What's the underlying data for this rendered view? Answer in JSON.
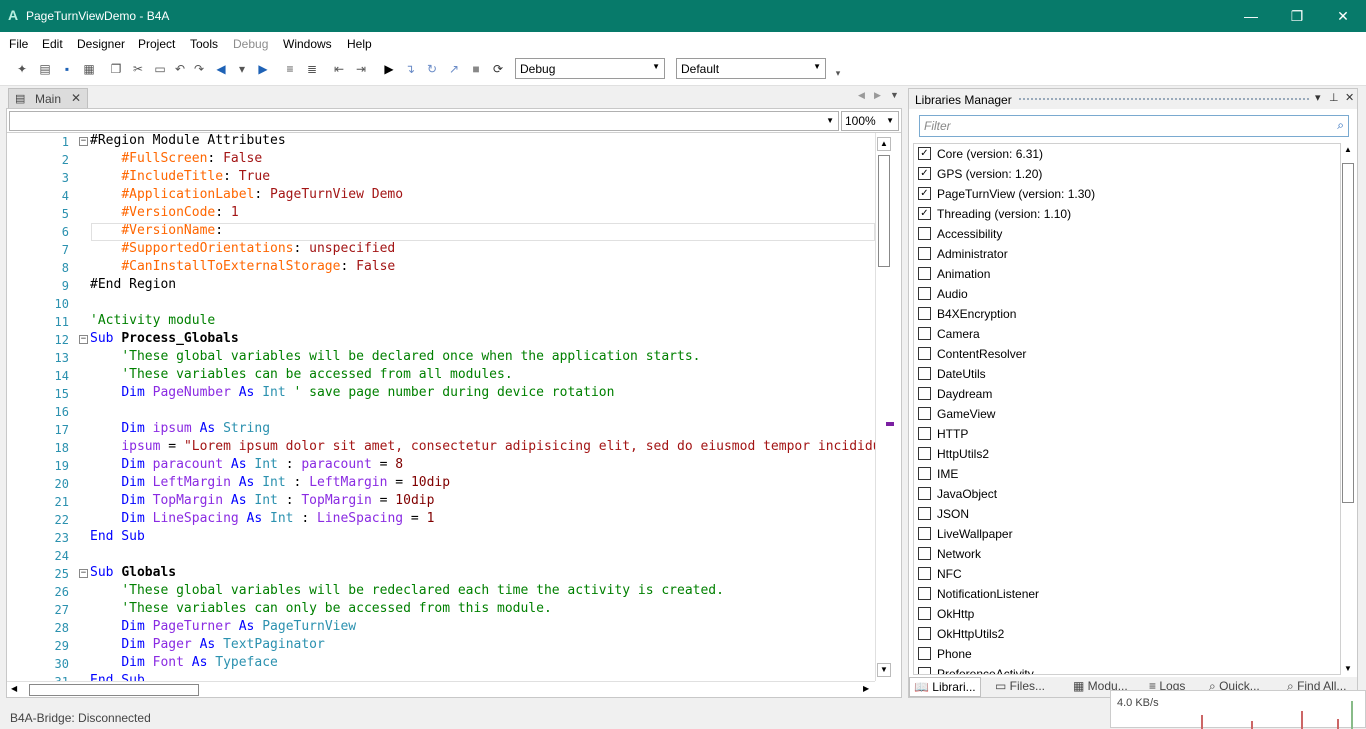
{
  "window": {
    "title": "PageTurnViewDemo - B4A",
    "logo": "A"
  },
  "menu": [
    "File",
    "Edit",
    "Designer",
    "Project",
    "Tools",
    "Debug",
    "Windows",
    "Help"
  ],
  "toolbar": {
    "build_mode": "Debug",
    "build_config": "Default"
  },
  "doc_tab": {
    "label": "Main"
  },
  "editor": {
    "zoom": "100%"
  },
  "code_lines": [
    {
      "n": "1",
      "html": "<span class='fold'>−</span><span class='src'>#Region Module Attributes</span>"
    },
    {
      "n": "2",
      "html": "<span class='src'>    <span class='attr'>#FullScreen</span>: <span class='str'>False</span></span>"
    },
    {
      "n": "3",
      "html": "<span class='src'>    <span class='attr'>#IncludeTitle</span>: <span class='str'>True</span></span>"
    },
    {
      "n": "4",
      "html": "<span class='src'>    <span class='attr'>#ApplicationLabel</span>: <span class='str'>PageTurnView Demo</span></span>"
    },
    {
      "n": "5",
      "html": "<span class='src'>    <span class='attr'>#VersionCode</span>: <span class='str'>1</span></span>"
    },
    {
      "n": "6",
      "html": "<span class='src'>    <span class='attr'>#VersionName</span>:</span>"
    },
    {
      "n": "7",
      "html": "<span class='src'>    <span class='attr'>#SupportedOrientations</span>: <span class='str'>unspecified</span></span>"
    },
    {
      "n": "8",
      "html": "<span class='src'>    <span class='attr'>#CanInstallToExternalStorage</span>: <span class='str'>False</span></span>"
    },
    {
      "n": "9",
      "html": "<span class='src'>#End Region</span>"
    },
    {
      "n": "10",
      "html": ""
    },
    {
      "n": "11",
      "html": "<span class='src'><span class='cm'>'Activity module</span></span>"
    },
    {
      "n": "12",
      "html": "<span class='fold'>−</span><span class='src'><span class='kw'>Sub</span> <b>Process_Globals</b></span>"
    },
    {
      "n": "13",
      "html": "<span class='src'>    <span class='cm'>'These global variables will be declared once when the application starts.</span></span>"
    },
    {
      "n": "14",
      "html": "<span class='src'>    <span class='cm'>'These variables can be accessed from all modules.</span></span>"
    },
    {
      "n": "15",
      "html": "<span class='src'>    <span class='kw'>Dim</span> <span class='var'>PageNumber</span> <span class='kw'>As</span> <span class='type'>Int</span> <span class='cm'>' save page number during device rotation</span></span>"
    },
    {
      "n": "16",
      "html": ""
    },
    {
      "n": "17",
      "html": "<span class='src'>    <span class='kw'>Dim</span> <span class='var'>ipsum</span> <span class='kw'>As</span> <span class='type'>String</span></span>"
    },
    {
      "n": "18",
      "html": "<span class='src'>    <span class='var'>ipsum</span> = <span class='str'>\"Lorem ipsum dolor sit amet, consectetur adipisicing elit, sed do eiusmod tempor incididunt</span></span>"
    },
    {
      "n": "19",
      "html": "<span class='src'>    <span class='kw'>Dim</span> <span class='var'>paracount</span> <span class='kw'>As</span> <span class='type'>Int</span> : <span class='var'>paracount</span> = <span class='num'>8</span></span>"
    },
    {
      "n": "20",
      "html": "<span class='src'>    <span class='kw'>Dim</span> <span class='var'>LeftMargin</span> <span class='kw'>As</span> <span class='type'>Int</span> : <span class='var'>LeftMargin</span> = <span class='num'>10dip</span></span>"
    },
    {
      "n": "21",
      "html": "<span class='src'>    <span class='kw'>Dim</span> <span class='var'>TopMargin</span> <span class='kw'>As</span> <span class='type'>Int</span> : <span class='var'>TopMargin</span> = <span class='num'>10dip</span></span>"
    },
    {
      "n": "22",
      "html": "<span class='src'>    <span class='kw'>Dim</span> <span class='var'>LineSpacing</span> <span class='kw'>As</span> <span class='type'>Int</span> : <span class='var'>LineSpacing</span> = <span class='num'>1</span></span>"
    },
    {
      "n": "23",
      "html": "<span class='src'><span class='kw'>End Sub</span></span>"
    },
    {
      "n": "24",
      "html": ""
    },
    {
      "n": "25",
      "html": "<span class='fold'>−</span><span class='src'><span class='kw'>Sub</span> <b>Globals</b></span>"
    },
    {
      "n": "26",
      "html": "<span class='src'>    <span class='cm'>'These global variables will be redeclared each time the activity is created.</span></span>"
    },
    {
      "n": "27",
      "html": "<span class='src'>    <span class='cm'>'These variables can only be accessed from this module.</span></span>"
    },
    {
      "n": "28",
      "html": "<span class='src'>    <span class='kw'>Dim</span> <span class='var'>PageTurner</span> <span class='kw'>As</span> <span class='type'>PageTurnView</span></span>"
    },
    {
      "n": "29",
      "html": "<span class='src'>    <span class='kw'>Dim</span> <span class='var'>Pager</span> <span class='kw'>As</span> <span class='type'>TextPaginator</span></span>"
    },
    {
      "n": "30",
      "html": "<span class='src'>    <span class='kw'>Dim</span> <span class='var'>Font</span> <span class='kw'>As</span> <span class='type'>Typeface</span></span>"
    },
    {
      "n": "31",
      "html": "<span class='src'><span class='kw'>End Sub</span></span>"
    }
  ],
  "libraries": {
    "title": "Libraries Manager",
    "filter_placeholder": "Filter",
    "items": [
      {
        "name": "Core (version: 6.31)",
        "checked": true
      },
      {
        "name": "GPS (version: 1.20)",
        "checked": true
      },
      {
        "name": "PageTurnView (version: 1.30)",
        "checked": true
      },
      {
        "name": "Threading (version: 1.10)",
        "checked": true
      },
      {
        "name": "Accessibility",
        "checked": false
      },
      {
        "name": "Administrator",
        "checked": false
      },
      {
        "name": "Animation",
        "checked": false
      },
      {
        "name": "Audio",
        "checked": false
      },
      {
        "name": "B4XEncryption",
        "checked": false
      },
      {
        "name": "Camera",
        "checked": false
      },
      {
        "name": "ContentResolver",
        "checked": false
      },
      {
        "name": "DateUtils",
        "checked": false
      },
      {
        "name": "Daydream",
        "checked": false
      },
      {
        "name": "GameView",
        "checked": false
      },
      {
        "name": "HTTP",
        "checked": false
      },
      {
        "name": "HttpUtils2",
        "checked": false
      },
      {
        "name": "IME",
        "checked": false
      },
      {
        "name": "JavaObject",
        "checked": false
      },
      {
        "name": "JSON",
        "checked": false
      },
      {
        "name": "LiveWallpaper",
        "checked": false
      },
      {
        "name": "Network",
        "checked": false
      },
      {
        "name": "NFC",
        "checked": false
      },
      {
        "name": "NotificationListener",
        "checked": false
      },
      {
        "name": "OkHttp",
        "checked": false
      },
      {
        "name": "OkHttpUtils2",
        "checked": false
      },
      {
        "name": "Phone",
        "checked": false
      },
      {
        "name": "PreferenceActivity",
        "checked": false
      }
    ],
    "tabs": [
      "Librari...",
      "Files...",
      "Modu...",
      "Logs",
      "Quick...",
      "Find All..."
    ]
  },
  "status": {
    "bridge": "B4A-Bridge: Disconnected",
    "net_speed": "4.0 KB/s"
  }
}
